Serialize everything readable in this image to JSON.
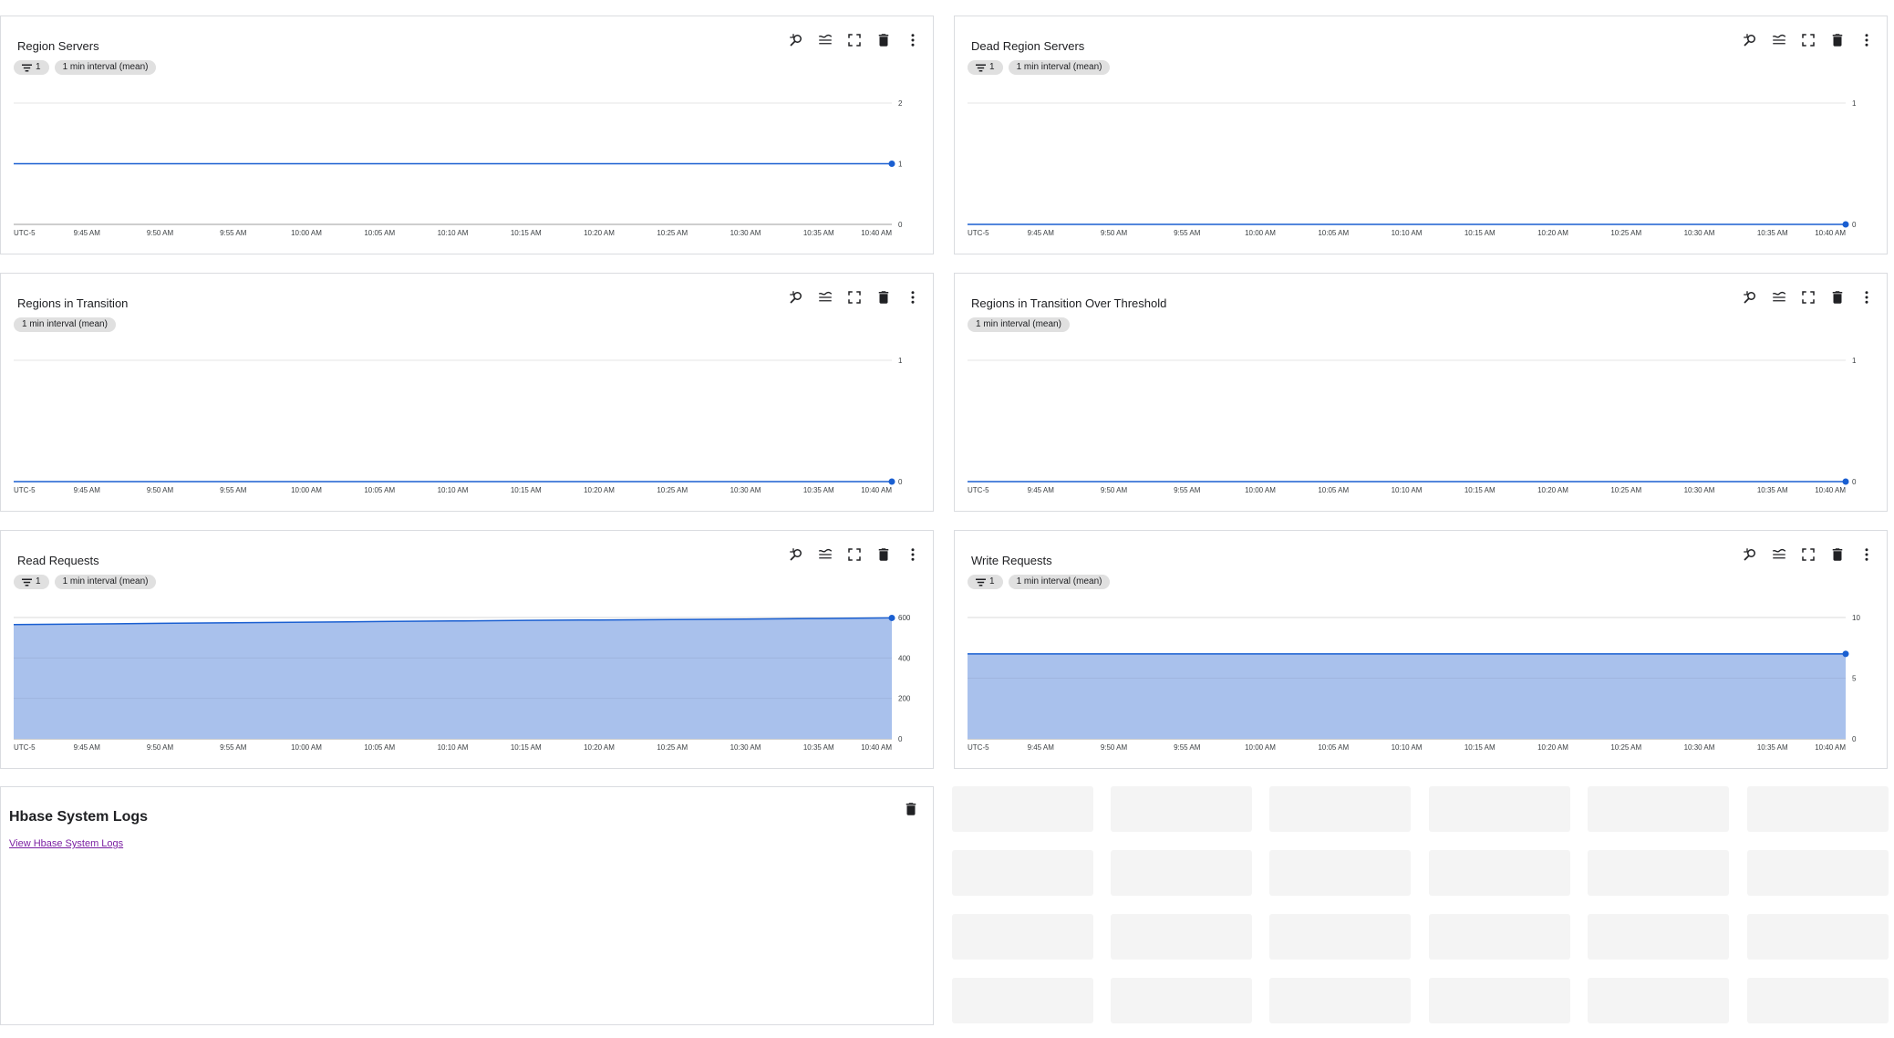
{
  "charts": [
    {
      "title": "Region Servers",
      "chips": [
        {
          "filter": true,
          "label": "1"
        },
        {
          "filter": false,
          "label": "1 min interval (mean)"
        }
      ],
      "chart_data": {
        "type": "line",
        "x": [
          "UTC-5",
          "9:45 AM",
          "9:50 AM",
          "9:55 AM",
          "10:00 AM",
          "10:05 AM",
          "10:10 AM",
          "10:15 AM",
          "10:20 AM",
          "10:25 AM",
          "10:30 AM",
          "10:35 AM",
          "10:40 AM"
        ],
        "y_ticks": [
          "0",
          "1",
          "2"
        ],
        "ylim": [
          0,
          2
        ],
        "series": [
          {
            "values": [
              1,
              1,
              1,
              1,
              1,
              1,
              1,
              1,
              1,
              1,
              1,
              1,
              1
            ]
          }
        ]
      }
    },
    {
      "title": "Dead Region Servers",
      "chips": [
        {
          "filter": true,
          "label": "1"
        },
        {
          "filter": false,
          "label": "1 min interval (mean)"
        }
      ],
      "chart_data": {
        "type": "line",
        "x": [
          "UTC-5",
          "9:45 AM",
          "9:50 AM",
          "9:55 AM",
          "10:00 AM",
          "10:05 AM",
          "10:10 AM",
          "10:15 AM",
          "10:20 AM",
          "10:25 AM",
          "10:30 AM",
          "10:35 AM",
          "10:40 AM"
        ],
        "y_ticks": [
          "0",
          "1"
        ],
        "ylim": [
          0,
          1
        ],
        "series": [
          {
            "values": [
              0,
              0,
              0,
              0,
              0,
              0,
              0,
              0,
              0,
              0,
              0,
              0,
              0
            ]
          }
        ]
      }
    },
    {
      "title": "Regions in Transition",
      "chips": [
        {
          "filter": false,
          "label": "1 min interval (mean)"
        }
      ],
      "chart_data": {
        "type": "line",
        "x": [
          "UTC-5",
          "9:45 AM",
          "9:50 AM",
          "9:55 AM",
          "10:00 AM",
          "10:05 AM",
          "10:10 AM",
          "10:15 AM",
          "10:20 AM",
          "10:25 AM",
          "10:30 AM",
          "10:35 AM",
          "10:40 AM"
        ],
        "y_ticks": [
          "0",
          "1"
        ],
        "ylim": [
          0,
          1
        ],
        "series": [
          {
            "values": [
              0,
              0,
              0,
              0,
              0,
              0,
              0,
              0,
              0,
              0,
              0,
              0,
              0
            ]
          }
        ]
      }
    },
    {
      "title": "Regions in Transition Over Threshold",
      "chips": [
        {
          "filter": false,
          "label": "1 min interval (mean)"
        }
      ],
      "chart_data": {
        "type": "line",
        "x": [
          "UTC-5",
          "9:45 AM",
          "9:50 AM",
          "9:55 AM",
          "10:00 AM",
          "10:05 AM",
          "10:10 AM",
          "10:15 AM",
          "10:20 AM",
          "10:25 AM",
          "10:30 AM",
          "10:35 AM",
          "10:40 AM"
        ],
        "y_ticks": [
          "0",
          "1"
        ],
        "ylim": [
          0,
          1
        ],
        "series": [
          {
            "values": [
              0,
              0,
              0,
              0,
              0,
              0,
              0,
              0,
              0,
              0,
              0,
              0,
              0
            ]
          }
        ]
      }
    },
    {
      "title": "Read Requests",
      "chips": [
        {
          "filter": true,
          "label": "1"
        },
        {
          "filter": false,
          "label": "1 min interval (mean)"
        }
      ],
      "chart_data": {
        "type": "area",
        "x": [
          "UTC-5",
          "9:45 AM",
          "9:50 AM",
          "9:55 AM",
          "10:00 AM",
          "10:05 AM",
          "10:10 AM",
          "10:15 AM",
          "10:20 AM",
          "10:25 AM",
          "10:30 AM",
          "10:35 AM",
          "10:40 AM"
        ],
        "y_ticks": [
          "0",
          "200",
          "400",
          "600"
        ],
        "ylim": [
          0,
          600
        ],
        "series": [
          {
            "values": [
              565,
              568,
              571,
              574,
              577,
              580,
              583,
              586,
              588,
              590,
              592,
              595,
              598
            ]
          }
        ]
      }
    },
    {
      "title": "Write Requests",
      "chips": [
        {
          "filter": true,
          "label": "1"
        },
        {
          "filter": false,
          "label": "1 min interval (mean)"
        }
      ],
      "chart_data": {
        "type": "area",
        "x": [
          "UTC-5",
          "9:45 AM",
          "9:50 AM",
          "9:55 AM",
          "10:00 AM",
          "10:05 AM",
          "10:10 AM",
          "10:15 AM",
          "10:20 AM",
          "10:25 AM",
          "10:30 AM",
          "10:35 AM",
          "10:40 AM"
        ],
        "y_ticks": [
          "0",
          "5",
          "10"
        ],
        "ylim": [
          0,
          10
        ],
        "series": [
          {
            "values": [
              7,
              7,
              7,
              7,
              7,
              7,
              7,
              7,
              7,
              7,
              7,
              7,
              7
            ]
          }
        ]
      }
    }
  ],
  "logs": {
    "title": "Hbase System Logs",
    "link": "View Hbase System Logs"
  },
  "toolbar_icons": [
    "zoom-reset-icon",
    "legend-icon",
    "fullscreen-icon",
    "delete-icon",
    "more-options-icon"
  ],
  "colors": {
    "accent": "#1a5fd1",
    "area_fill": "#a9c1ec",
    "grid": "#e6e6e6",
    "link": "#7b1fa2",
    "skeleton": "#f4f4f4"
  }
}
